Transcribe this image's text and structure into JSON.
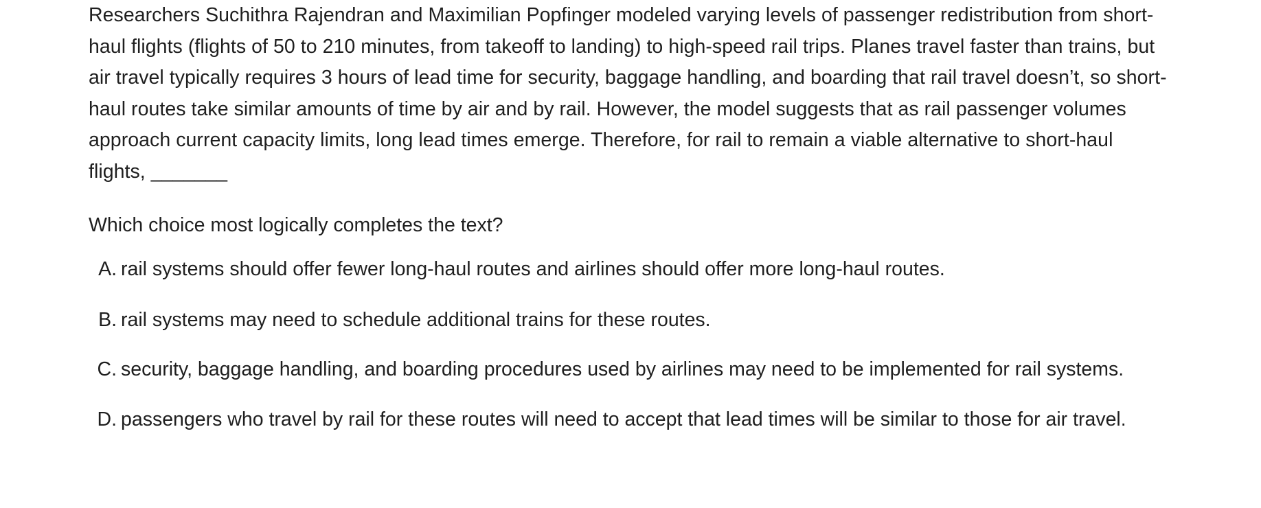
{
  "passage": "Researchers Suchithra Rajendran and Maximilian Popfinger modeled varying levels of passenger redistribution from short-haul flights (flights of 50 to 210 minutes, from takeoff to landing) to high-speed rail trips. Planes travel faster than trains, but air travel typically requires 3 hours of lead time for security, baggage handling, and boarding that rail travel doesn’t, so short-haul routes take similar amounts of time by air and by rail. However, the model suggests that as rail passenger volumes approach current capacity limits, long lead times emerge. Therefore, for rail to remain a viable alternative to short-haul flights, _______",
  "question": "Which choice most logically completes the text?",
  "choices": [
    {
      "letter": "A.",
      "text": "rail systems should offer fewer long-haul routes and airlines should offer more long-haul routes."
    },
    {
      "letter": "B.",
      "text": "rail systems may need to schedule additional trains for these routes."
    },
    {
      "letter": "C.",
      "text": "security, baggage handling, and boarding procedures used by airlines may need to be implemented for rail systems."
    },
    {
      "letter": "D.",
      "text": "passengers who travel by rail for these routes will need to accept that lead times will be similar to those for air travel."
    }
  ]
}
